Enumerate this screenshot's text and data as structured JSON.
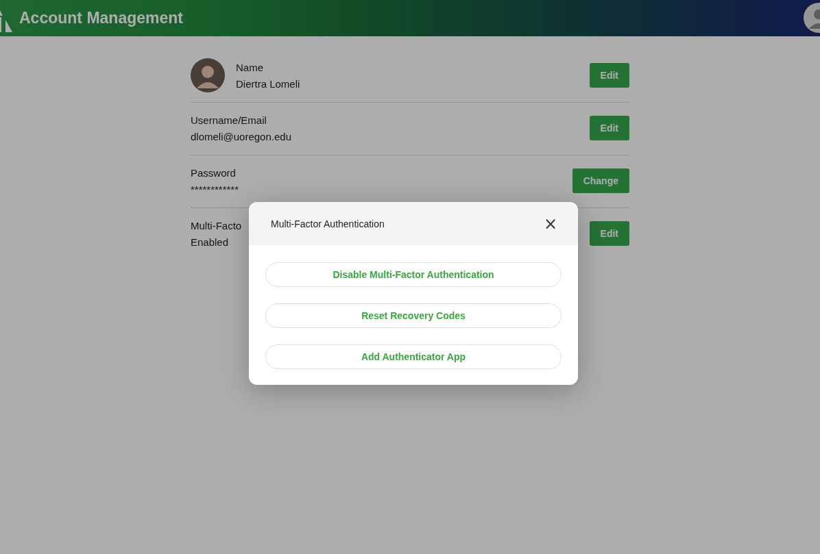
{
  "header": {
    "title": "Account Management"
  },
  "fields": [
    {
      "kind": "avatar",
      "label": "Name",
      "value": "Diertra Lomeli",
      "action": "Edit"
    },
    {
      "kind": "plain",
      "label": "Username/Email",
      "value": "dlomeli@uoregon.edu",
      "action": "Edit"
    },
    {
      "kind": "plain",
      "label": "Password",
      "value": "************",
      "action": "Change"
    },
    {
      "kind": "plain",
      "label": "Multi-Facto",
      "value": "Enabled",
      "action": "Edit"
    }
  ],
  "dialog": {
    "title": "Multi-Factor Authentication",
    "close": "×",
    "buttons": [
      "Disable Multi-Factor Authentication",
      "Reset Recovery Codes",
      "Add Authenticator App"
    ]
  }
}
